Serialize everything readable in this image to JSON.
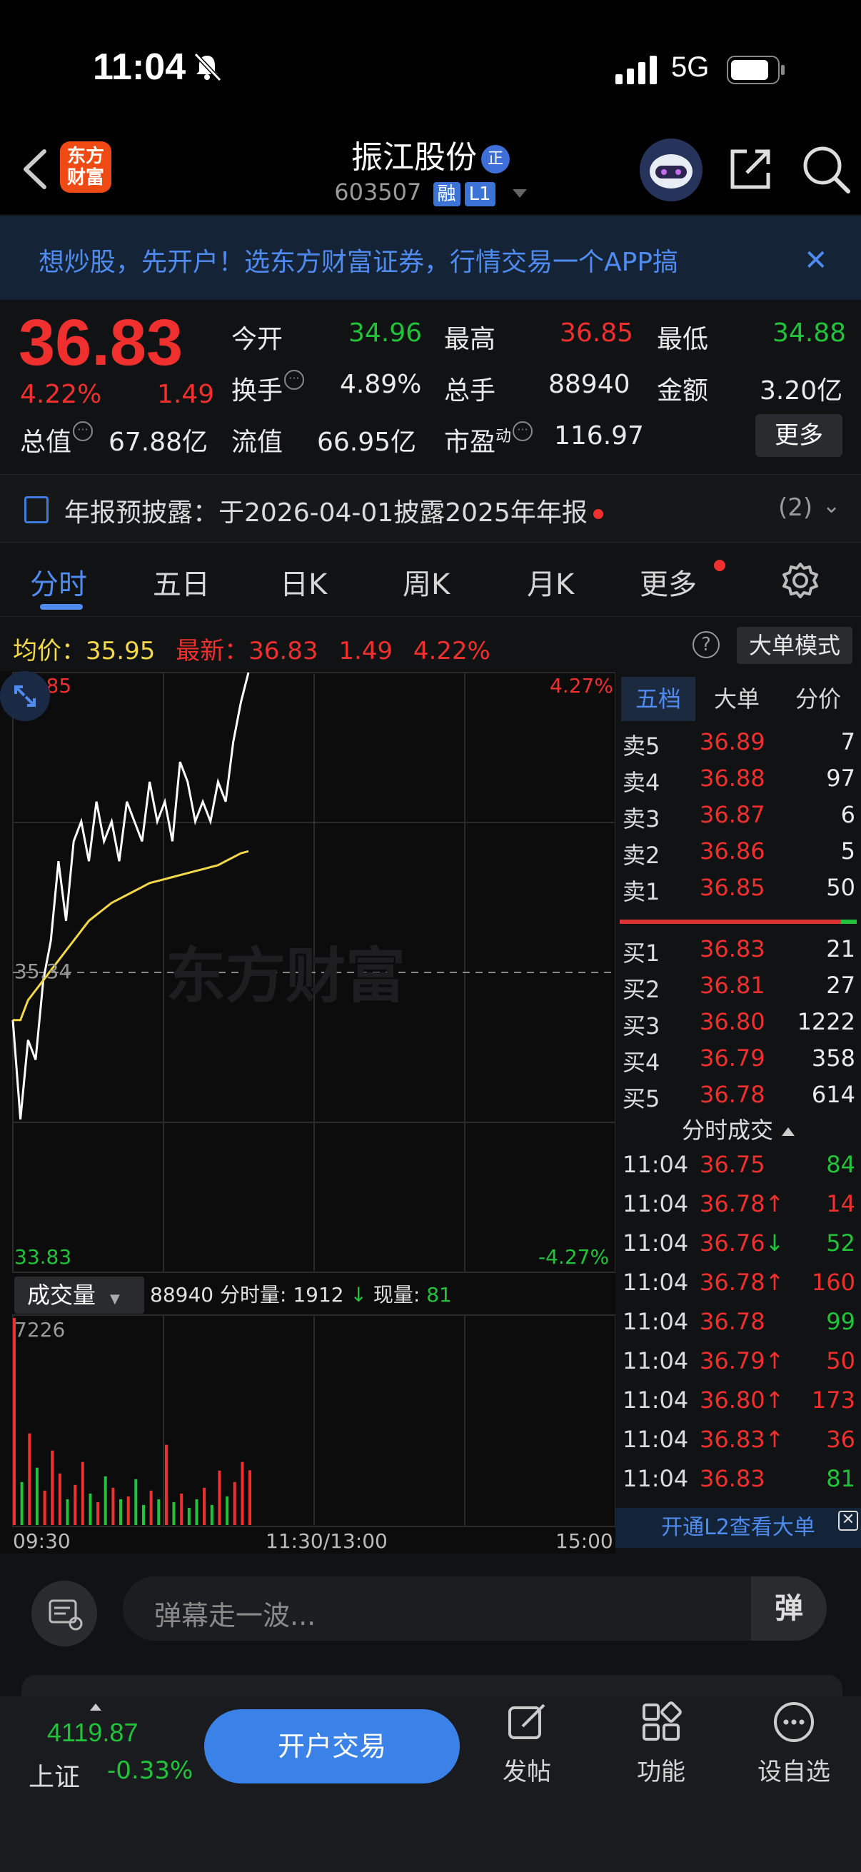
{
  "status": {
    "time": "11:04",
    "network": "5G"
  },
  "header": {
    "logo": "东方财富",
    "stock_name": "振江股份",
    "name_badge": "正",
    "code": "603507",
    "tag_rong": "融",
    "tag_level": "L1"
  },
  "banner": {
    "text": "想炒股，先开户！选东方财富证券，行情交易一个APP搞"
  },
  "quote": {
    "price": "36.83",
    "change_pct": "4.22%",
    "change": "1.49",
    "open_label": "今开",
    "open": "34.96",
    "high_label": "最高",
    "high": "36.85",
    "low_label": "最低",
    "low": "34.88",
    "turnover_label": "换手",
    "turnover": "4.89%",
    "volume_label": "总手",
    "volume": "88940",
    "amount_label": "金额",
    "amount": "3.20亿",
    "mktcap_label": "总值",
    "mktcap": "67.88亿",
    "float_label": "流值",
    "float": "66.95亿",
    "pe_label": "市盈",
    "pe_sup": "动",
    "pe": "116.97",
    "more": "更多"
  },
  "announcement": {
    "text": "年报预披露：于2026-04-01披露2025年年报",
    "count": "(2)"
  },
  "tabs": [
    "分时",
    "五日",
    "日K",
    "周K",
    "月K",
    "更多"
  ],
  "avg": {
    "avg_label": "均价：",
    "avg_value": "35.95",
    "latest_label": "最新：",
    "latest_value": "36.83",
    "latest_change": "1.49",
    "latest_pct": "4.22%",
    "mode_button": "大单模式"
  },
  "chart_labels": {
    "top_price": "36.85",
    "top_pct": "4.27%",
    "mid_price": "35.34",
    "bottom_price": "33.83",
    "bottom_pct": "-4.27%",
    "vol_max": "7226",
    "time_start": "09:30",
    "time_mid": "11:30/13:00",
    "time_end": "15:00",
    "watermark": "东方财富"
  },
  "volume_panel": {
    "selector": "成交量",
    "total": "88940",
    "minute_label": "分时量:",
    "minute_value": "1912",
    "now_label": "现量:",
    "now_value": "81"
  },
  "book_tabs": [
    "五档",
    "大单",
    "分价"
  ],
  "asks": [
    {
      "label": "卖5",
      "price": "36.89",
      "vol": "7"
    },
    {
      "label": "卖4",
      "price": "36.88",
      "vol": "97"
    },
    {
      "label": "卖3",
      "price": "36.87",
      "vol": "6"
    },
    {
      "label": "卖2",
      "price": "36.86",
      "vol": "5"
    },
    {
      "label": "卖1",
      "price": "36.85",
      "vol": "50"
    }
  ],
  "bids": [
    {
      "label": "买1",
      "price": "36.83",
      "vol": "21"
    },
    {
      "label": "买2",
      "price": "36.81",
      "vol": "27"
    },
    {
      "label": "买3",
      "price": "36.80",
      "vol": "1222"
    },
    {
      "label": "买4",
      "price": "36.79",
      "vol": "358"
    },
    {
      "label": "买5",
      "price": "36.78",
      "vol": "614"
    }
  ],
  "ticks_title": "分时成交",
  "ticks": [
    {
      "time": "11:04",
      "price": "36.75",
      "vol": "84",
      "side": "sell"
    },
    {
      "time": "11:04",
      "price": "36.78↑",
      "vol": "14",
      "side": "buy"
    },
    {
      "time": "11:04",
      "price": "36.76↓",
      "vol": "52",
      "side": "sell"
    },
    {
      "time": "11:04",
      "price": "36.78↑",
      "vol": "160",
      "side": "buy"
    },
    {
      "time": "11:04",
      "price": "36.78",
      "vol": "99",
      "side": "sell"
    },
    {
      "time": "11:04",
      "price": "36.79↑",
      "vol": "50",
      "side": "buy"
    },
    {
      "time": "11:04",
      "price": "36.80↑",
      "vol": "173",
      "side": "buy"
    },
    {
      "time": "11:04",
      "price": "36.83↑",
      "vol": "36",
      "side": "buy"
    },
    {
      "time": "11:04",
      "price": "36.83",
      "vol": "81",
      "side": "sell"
    }
  ],
  "l2_banner": "开通L2查看大单",
  "comment": {
    "placeholder": "弹幕走一波...",
    "dan": "弹"
  },
  "bottom": {
    "index_value": "4119.87",
    "index_name": "上证",
    "index_pct": "-0.33%",
    "trade_button": "开户交易",
    "nav": [
      "发帖",
      "功能",
      "设自选"
    ]
  },
  "colors": {
    "up": "#f0302e",
    "down": "#22c33b",
    "accent": "#4f8bf0",
    "avg_line": "#f3d84a"
  },
  "chart_data": {
    "type": "line",
    "series": [
      {
        "values": [
          35.1,
          34.6,
          35.0,
          34.9,
          35.3,
          35.5,
          35.9,
          35.6,
          36.0,
          36.1,
          35.9,
          36.2,
          36.0,
          36.1,
          35.9,
          36.2,
          36.1,
          36.0,
          36.3,
          36.1,
          36.2,
          36.0,
          36.4,
          36.3,
          36.1,
          36.2,
          36.1,
          36.3,
          36.2,
          36.5,
          36.7,
          36.85
        ]
      },
      {
        "values": [
          35.1,
          35.1,
          35.2,
          35.25,
          35.3,
          35.35,
          35.4,
          35.45,
          35.5,
          35.55,
          35.6,
          35.63,
          35.66,
          35.69,
          35.71,
          35.73,
          35.75,
          35.77,
          35.79,
          35.8,
          35.81,
          35.82,
          35.83,
          35.84,
          35.85,
          35.86,
          35.87,
          35.88,
          35.9,
          35.92,
          35.94,
          35.95
        ]
      }
    ],
    "ylim": [
      33.83,
      36.85
    ],
    "volumes": [
      7226,
      1500,
      3200,
      2000,
      1200,
      2600,
      1800,
      900,
      1400,
      2200,
      1100,
      800,
      1700,
      1300,
      900,
      1000,
      1600,
      700,
      1200,
      900,
      2800,
      800,
      1100,
      600,
      900,
      1300,
      700,
      1900,
      1000,
      1500,
      2200,
      1912
    ]
  }
}
